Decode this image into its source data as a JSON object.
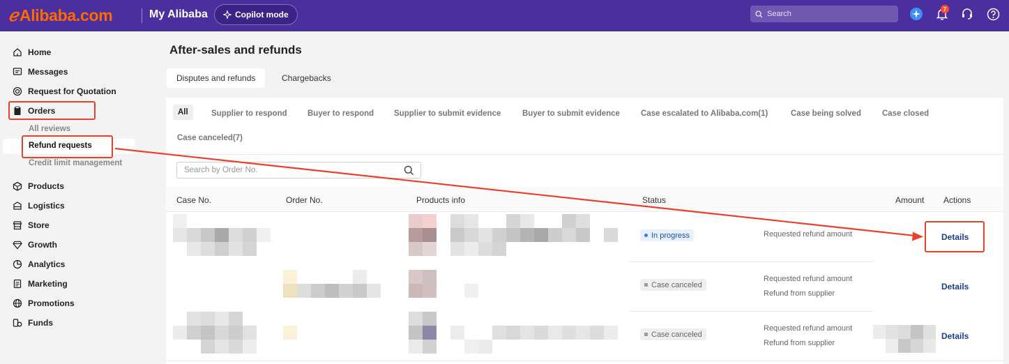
{
  "header": {
    "logo_text": "Alibaba.com",
    "app_title": "My Alibaba",
    "copilot_label": "Copilot mode",
    "search_placeholder": "Search",
    "notification_count": "7"
  },
  "sidebar": {
    "items": [
      {
        "label": "Home",
        "icon": "home-icon"
      },
      {
        "label": "Messages",
        "icon": "message-icon"
      },
      {
        "label": "Request for Quotation",
        "icon": "target-icon"
      },
      {
        "label": "Orders",
        "icon": "clipboard-icon"
      },
      {
        "label": "Products",
        "icon": "cube-icon"
      },
      {
        "label": "Logistics",
        "icon": "box-icon"
      },
      {
        "label": "Store",
        "icon": "store-icon"
      },
      {
        "label": "Growth",
        "icon": "diamond-icon"
      },
      {
        "label": "Analytics",
        "icon": "pie-icon"
      },
      {
        "label": "Marketing",
        "icon": "document-icon"
      },
      {
        "label": "Promotions",
        "icon": "globe-icon"
      },
      {
        "label": "Funds",
        "icon": "coins-icon"
      }
    ],
    "orders_sub": [
      "All reviews",
      "Refund requests",
      "Credit limit management"
    ]
  },
  "main": {
    "title": "After-sales and refunds",
    "tabs": [
      "Disputes and refunds",
      "Chargebacks"
    ],
    "filters": [
      "All",
      "Supplier to respond",
      "Buyer to respond",
      "Supplier to submit evidence",
      "Buyer to submit evidence",
      "Case escalated to Alibaba.com(1)",
      "Case being solved",
      "Case closed",
      "Case canceled(7)"
    ],
    "search_placeholder": "Search by Order No.",
    "columns": [
      "Case No.",
      "Order No.",
      "Products info",
      "Status",
      "Amount",
      "Actions"
    ],
    "rows": [
      {
        "status": "In progress",
        "amount_lines": [
          "Requested refund amount"
        ],
        "action": "Details"
      },
      {
        "status": "Case canceled",
        "amount_lines": [
          "Requested refund amount",
          "Refund from supplier"
        ],
        "action": "Details"
      },
      {
        "status": "Case canceled",
        "amount_lines": [
          "Requested refund amount",
          "Refund from supplier"
        ],
        "action": "Details"
      }
    ]
  },
  "colors": {
    "header_bg": "#4b2f9e",
    "brand_orange": "#ff6a00",
    "annotation_red": "#e8402a",
    "link_blue": "#1a3d8f"
  }
}
